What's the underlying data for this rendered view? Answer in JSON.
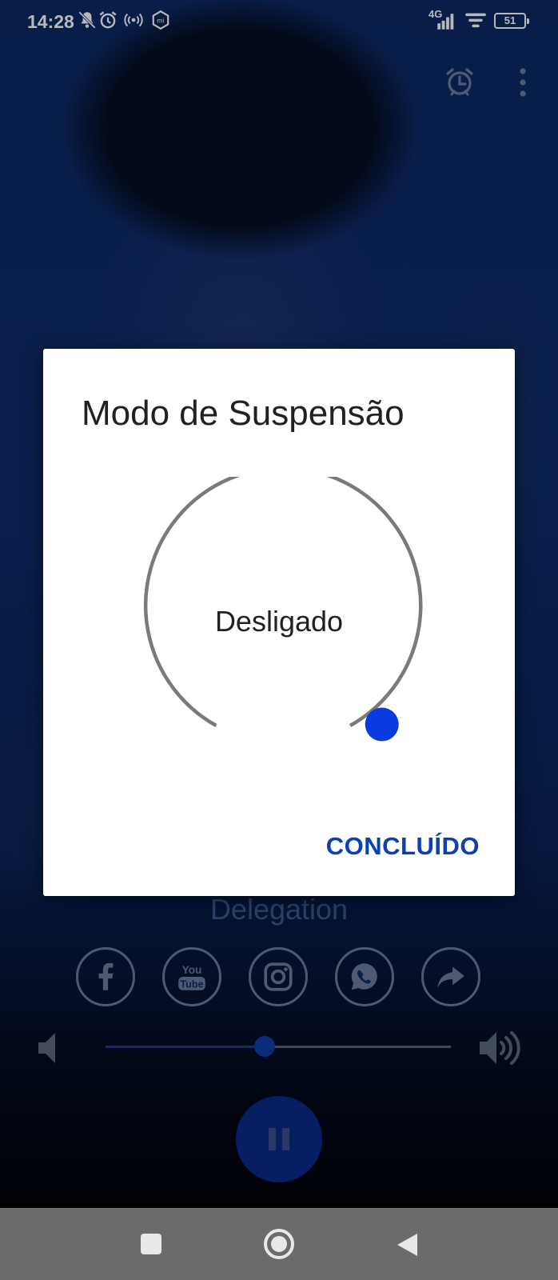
{
  "status_bar": {
    "time": "14:28",
    "network": "4G",
    "battery": "51",
    "icons": [
      "bell-muted-icon",
      "alarm-icon",
      "hotspot-icon",
      "mi-icon",
      "signal-icon",
      "wifi-icon",
      "battery-icon"
    ]
  },
  "top_actions": {
    "icons": [
      "sleep-timer-icon",
      "more-vert-icon"
    ]
  },
  "player": {
    "station_name": "Delegation",
    "social_icons": [
      "facebook-icon",
      "youtube-icon",
      "instagram-icon",
      "whatsapp-icon",
      "share-icon"
    ],
    "youtube_text": [
      "You",
      "Tube"
    ],
    "volume_level": 0.46,
    "state": "playing"
  },
  "dialog": {
    "title": "Modo de Suspensão",
    "value_label": "Desligado",
    "done_label": "CONCLUÍDO",
    "dial_value": 0
  },
  "colors": {
    "accent": "#0d3fb5",
    "dial_track": "#7a7a7a",
    "dial_thumb": "#0a3be0"
  },
  "nav_bar": {
    "icons": [
      "recents-icon",
      "home-icon",
      "back-icon"
    ]
  }
}
